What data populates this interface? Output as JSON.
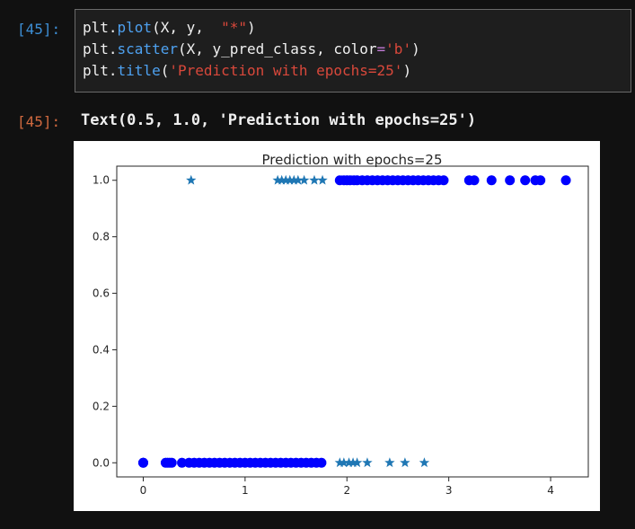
{
  "input_prompt": "[45]:",
  "output_prompt": "[45]:",
  "code": {
    "line1": [
      {
        "t": "plt.",
        "c": "plain"
      },
      {
        "t": "plot",
        "c": "fn"
      },
      {
        "t": "(X, y,  ",
        "c": "plain"
      },
      {
        "t": "\"*\"",
        "c": "str"
      },
      {
        "t": ")",
        "c": "plain"
      }
    ],
    "line2": [
      {
        "t": "plt.",
        "c": "plain"
      },
      {
        "t": "scatter",
        "c": "fn"
      },
      {
        "t": "(X, y_pred_class, color",
        "c": "plain"
      },
      {
        "t": "=",
        "c": "kw"
      },
      {
        "t": "'b'",
        "c": "str"
      },
      {
        "t": ")",
        "c": "plain"
      }
    ],
    "line3": [
      {
        "t": "plt.",
        "c": "plain"
      },
      {
        "t": "title",
        "c": "fn"
      },
      {
        "t": "(",
        "c": "plain"
      },
      {
        "t": "'Prediction with epochs=25'",
        "c": "str"
      },
      {
        "t": ")",
        "c": "plain"
      }
    ]
  },
  "output_text": "Text(0.5, 1.0, 'Prediction with epochs=25')",
  "colors": {
    "fn": "#4ea1f0",
    "str": "#d9483b",
    "kw": "#c17bd6",
    "star_color": "#1f77b4",
    "pred_color": "#0000ff"
  },
  "chart_data": {
    "type": "scatter",
    "title": "Prediction with epochs=25",
    "xlabel": "",
    "ylabel": "",
    "xlim": [
      -0.26,
      4.37
    ],
    "ylim": [
      -0.05,
      1.05
    ],
    "xticks": [
      0,
      1,
      2,
      3,
      4
    ],
    "yticks": [
      0.0,
      0.2,
      0.4,
      0.6,
      0.8,
      1.0
    ],
    "ytick_labels": [
      "0.0",
      "0.2",
      "0.4",
      "0.6",
      "0.8",
      "1.0"
    ],
    "grid": false,
    "series": [
      {
        "marker": "star",
        "color": "#1f77b4",
        "x": [
          0.0,
          0.0,
          0.22,
          0.24,
          0.26,
          0.28,
          0.38,
          0.45,
          0.5,
          0.55,
          0.6,
          0.65,
          0.7,
          0.75,
          0.8,
          0.85,
          0.9,
          0.95,
          1.0,
          1.05,
          1.1,
          1.15,
          1.2,
          1.25,
          1.3,
          1.35,
          1.4,
          1.45,
          1.5,
          1.55,
          1.6,
          1.65,
          1.7,
          1.75,
          0.47,
          1.32,
          1.36,
          1.4,
          1.44,
          1.48,
          1.52,
          1.58,
          1.68,
          1.76,
          1.93,
          1.97,
          2.02,
          2.06,
          2.1,
          2.2,
          2.42,
          2.57,
          2.76,
          1.95,
          2.0,
          2.05,
          2.1,
          2.15,
          2.2,
          2.25,
          2.3,
          2.35,
          2.4,
          2.45,
          2.5,
          2.55,
          2.6,
          2.65,
          2.7,
          2.75,
          2.8,
          2.85,
          2.9,
          2.95,
          3.2,
          3.25,
          3.42,
          3.6,
          3.75,
          3.85,
          3.9,
          4.15
        ],
        "y": [
          0,
          0,
          0,
          0,
          0,
          0,
          0,
          0,
          0,
          0,
          0,
          0,
          0,
          0,
          0,
          0,
          0,
          0,
          0,
          0,
          0,
          0,
          0,
          0,
          0,
          0,
          0,
          0,
          0,
          0,
          0,
          0,
          0,
          0,
          1,
          1,
          1,
          1,
          1,
          1,
          1,
          1,
          1,
          1,
          0,
          0,
          0,
          0,
          0,
          0,
          0,
          0,
          0,
          1,
          1,
          1,
          1,
          1,
          1,
          1,
          1,
          1,
          1,
          1,
          1,
          1,
          1,
          1,
          1,
          1,
          1,
          1,
          1,
          1,
          1,
          1,
          1,
          1,
          1,
          1,
          1,
          1
        ]
      },
      {
        "marker": "circle",
        "color": "#0000ff",
        "x": [
          0.0,
          0.0,
          0.22,
          0.24,
          0.26,
          0.28,
          0.38,
          0.45,
          0.5,
          0.55,
          0.6,
          0.65,
          0.7,
          0.75,
          0.8,
          0.85,
          0.9,
          0.95,
          1.0,
          1.05,
          1.1,
          1.15,
          1.2,
          1.25,
          1.3,
          1.35,
          1.4,
          1.45,
          1.5,
          1.55,
          1.6,
          1.65,
          1.7,
          1.75,
          1.93,
          1.97,
          2.0,
          2.03,
          2.07,
          2.1,
          2.15,
          2.2,
          2.25,
          2.3,
          2.35,
          2.4,
          2.45,
          2.5,
          2.55,
          2.6,
          2.65,
          2.7,
          2.75,
          2.8,
          2.85,
          2.9,
          2.95,
          3.2,
          3.25,
          3.42,
          3.6,
          3.75,
          3.85,
          3.9,
          4.15
        ],
        "y": [
          0,
          0,
          0,
          0,
          0,
          0,
          0,
          0,
          0,
          0,
          0,
          0,
          0,
          0,
          0,
          0,
          0,
          0,
          0,
          0,
          0,
          0,
          0,
          0,
          0,
          0,
          0,
          0,
          0,
          0,
          0,
          0,
          0,
          0,
          1,
          1,
          1,
          1,
          1,
          1,
          1,
          1,
          1,
          1,
          1,
          1,
          1,
          1,
          1,
          1,
          1,
          1,
          1,
          1,
          1,
          1,
          1,
          1,
          1,
          1,
          1,
          1,
          1,
          1,
          1
        ]
      }
    ]
  }
}
